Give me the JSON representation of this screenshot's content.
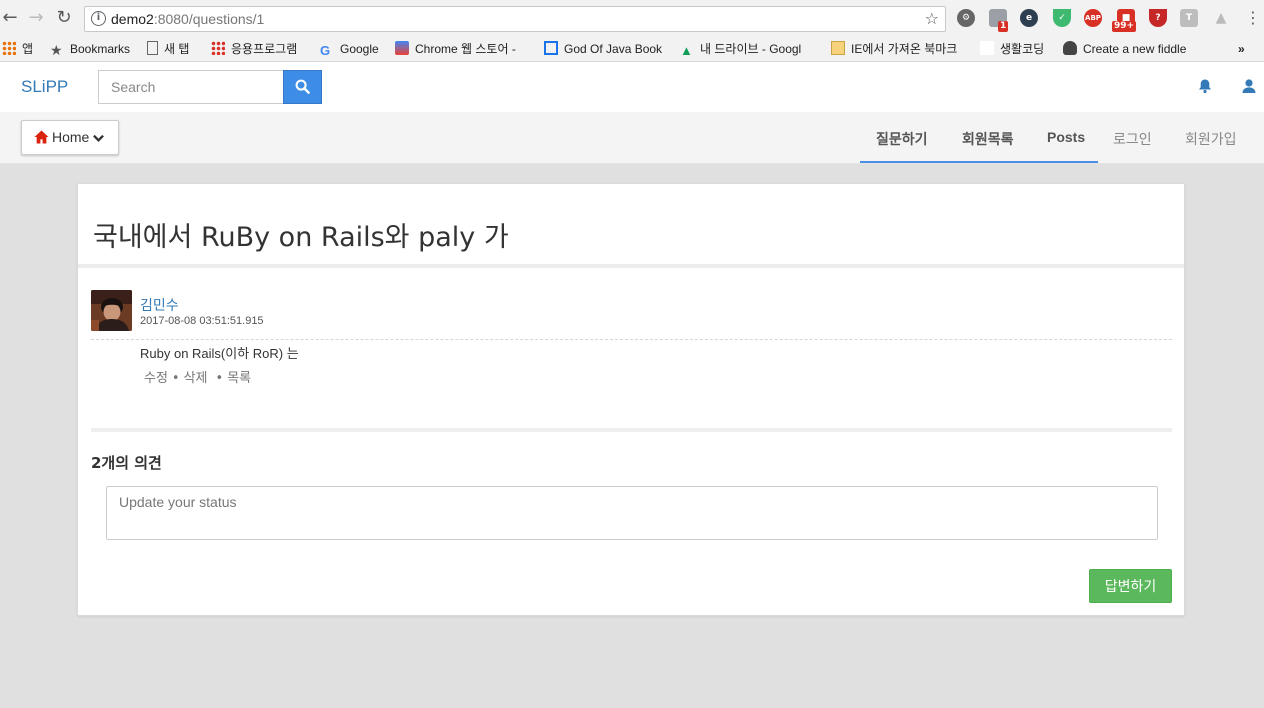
{
  "browser": {
    "url_host": "demo2",
    "url_rest": ":8080/questions/1",
    "extensions": [
      "gear-ext",
      "badge-ext",
      "e-ext",
      "shield-ext",
      "abp-ext",
      "notif-ext",
      "red-shield-ext",
      "t-ext",
      "drive-ext"
    ],
    "ext_badges": {
      "first": "1",
      "second": "99+"
    },
    "abp_label": "ABP",
    "t_label": "T",
    "bookmarks": [
      {
        "label": "앱",
        "icon": "apps-grid-icon"
      },
      {
        "label": "Bookmarks",
        "icon": "star-icon"
      },
      {
        "label": "새 탭",
        "icon": "page-icon"
      },
      {
        "label": "응용프로그램",
        "icon": "apps-grid-icon"
      },
      {
        "label": "Google",
        "icon": "google-icon"
      },
      {
        "label": "Chrome 웹 스토어 -",
        "icon": "chrome-store-icon"
      },
      {
        "label": "God Of Java Book",
        "icon": "board-icon"
      },
      {
        "label": "내 드라이브 - Googl",
        "icon": "drive-icon"
      },
      {
        "label": "IE에서 가져온 북마크",
        "icon": "folder-icon"
      },
      {
        "label": "생활코딩",
        "icon": "blank-icon"
      },
      {
        "label": "Create a new fiddle",
        "icon": "cloud-icon"
      }
    ],
    "more": "»"
  },
  "site": {
    "brand": "SLiPP",
    "search_placeholder": "Search"
  },
  "subnav": {
    "home_label": "Home",
    "links": [
      "질문하기",
      "회원목록",
      "Posts",
      "로그인",
      "회원가입"
    ]
  },
  "question": {
    "title": "국내에서 RuBy on Rails와 paly 가",
    "author": "김민수",
    "date": "2017-08-08 03:51:51.915",
    "body": "Ruby on Rails(이하 RoR) 는",
    "actions": {
      "edit": "수정",
      "delete": "삭제",
      "list": "목록",
      "dot": "•"
    }
  },
  "comments": {
    "heading": "2개의 의견",
    "placeholder": "Update your status",
    "submit_label": "답변하기"
  },
  "colors": {
    "brand": "#337ab7",
    "search_button": "#3d8de7",
    "submit": "#5cb85c",
    "nav_underline": "#4a90e2",
    "home_icon": "#d9230f"
  }
}
